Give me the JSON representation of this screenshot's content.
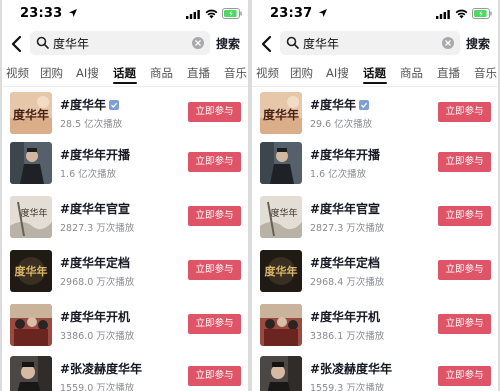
{
  "left": {
    "status_time": "23:33",
    "search": {
      "query": "度华年",
      "button_label": "搜索"
    },
    "tabs": [
      {
        "label": "视频",
        "active": false
      },
      {
        "label": "团购",
        "active": false
      },
      {
        "label": "AI搜",
        "active": false
      },
      {
        "label": "话题",
        "active": true
      },
      {
        "label": "商品",
        "active": false
      },
      {
        "label": "直播",
        "active": false
      },
      {
        "label": "音乐",
        "active": false
      }
    ],
    "rows": [
      {
        "title": "#度华年",
        "views": "28.5 亿次播放",
        "button": "立即参与",
        "verified": true
      },
      {
        "title": "#度华年开播",
        "views": "1.6 亿次播放",
        "button": "立即参与",
        "verified": false
      },
      {
        "title": "#度华年官宣",
        "views": "2827.3 万次播放",
        "button": "立即参与",
        "verified": false
      },
      {
        "title": "#度华年定档",
        "views": "2968.0 万次播放",
        "button": "立即参与",
        "verified": false
      },
      {
        "title": "#度华年开机",
        "views": "3386.0 万次播放",
        "button": "立即参与",
        "verified": false
      },
      {
        "title": "#张凌赫度华年",
        "views": "1559.0 万次播放",
        "button": "立即参与",
        "verified": false
      }
    ]
  },
  "right": {
    "status_time": "23:37",
    "search": {
      "query": "度华年",
      "button_label": "搜索"
    },
    "tabs": [
      {
        "label": "视频",
        "active": false
      },
      {
        "label": "团购",
        "active": false
      },
      {
        "label": "AI搜",
        "active": false
      },
      {
        "label": "话题",
        "active": true
      },
      {
        "label": "商品",
        "active": false
      },
      {
        "label": "直播",
        "active": false
      },
      {
        "label": "音乐",
        "active": false
      }
    ],
    "rows": [
      {
        "title": "#度华年",
        "views": "29.6 亿次播放",
        "button": "立即参与",
        "verified": true
      },
      {
        "title": "#度华年开播",
        "views": "1.6 亿次播放",
        "button": "立即参与",
        "verified": false
      },
      {
        "title": "#度华年官宣",
        "views": "2827.3 万次播放",
        "button": "立即参与",
        "verified": false
      },
      {
        "title": "#度华年定档",
        "views": "2968.4 万次播放",
        "button": "立即参与",
        "verified": false
      },
      {
        "title": "#度华年开机",
        "views": "3386.1 万次播放",
        "button": "立即参与",
        "verified": false
      },
      {
        "title": "#张凌赫度华年",
        "views": "1559.3 万次播放",
        "button": "立即参与",
        "verified": false
      }
    ]
  },
  "thumbnails": [
    {
      "icon": "calligraphy-logo-thumbnail",
      "logo_text": "度华年",
      "color": "#c9a27a"
    },
    {
      "icon": "costume-actor-thumbnail",
      "color": "#4a4e55"
    },
    {
      "icon": "misty-poster-thumbnail",
      "logo_text": "度华年",
      "color": "#d8d4cc"
    },
    {
      "icon": "dark-gold-poster-thumbnail",
      "logo_text": "度华年",
      "color": "#2a241c"
    },
    {
      "icon": "crowd-scene-thumbnail",
      "color": "#8a3a32"
    },
    {
      "icon": "actor-portrait-thumbnail",
      "color": "#3c3a38"
    }
  ],
  "colors": {
    "join_button": "#e05468",
    "title_text": "#161823",
    "meta_text": "#8a8b91",
    "battery_fill": "#4cd964"
  },
  "battery_level": 0.9
}
